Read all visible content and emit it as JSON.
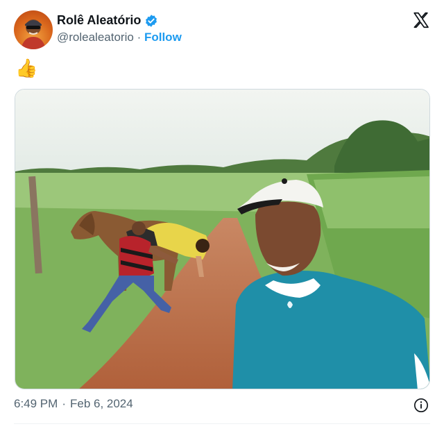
{
  "author": {
    "name": "Rolê Aleatório",
    "handle": "@rolealeatorio",
    "separator": "·",
    "follow_label": "Follow",
    "verified": true
  },
  "post": {
    "text": "👍",
    "image_alt": "Man taking a selfie on a dirt road while a boy wearing a red and black striped shirt catches a girl falling off a brown horse"
  },
  "meta": {
    "time": "6:49 PM",
    "separator": "·",
    "date": "Feb 6, 2024"
  },
  "colors": {
    "accent": "#1d9bf0",
    "text": "#0f1419",
    "muted": "#536471"
  },
  "icons": {
    "platform": "x-logo-icon",
    "info": "info-icon",
    "verified": "verified-badge-icon"
  }
}
